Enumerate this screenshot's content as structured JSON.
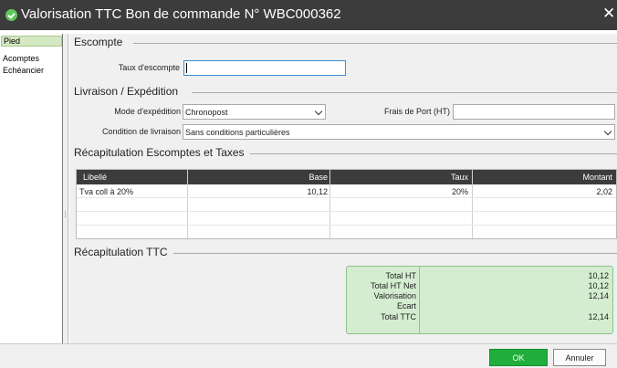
{
  "window": {
    "title": "Valorisation TTC Bon de commande N° WBC000362",
    "close_glyph": "✕",
    "icon": "green-check-badge-icon"
  },
  "sidebar": {
    "items": [
      "Pied",
      "Acomptes",
      "Echéancier"
    ],
    "active": "Pied"
  },
  "escompte": {
    "section_title": "Escompte",
    "rate_label": "Taux d'escompte",
    "rate_value": ""
  },
  "livraison": {
    "section_title": "Livraison / Expédition",
    "mode_label": "Mode d'expédition",
    "mode_value": "Chronopost",
    "frais_label": "Frais de Port (HT)",
    "frais_value": "",
    "condition_label": "Condition de livraison",
    "condition_value": "Sans conditions particulières"
  },
  "taxes": {
    "section_title": "Récapitulation Escomptes et Taxes",
    "columns": [
      "Libellé",
      "Base",
      "Taux",
      "Montant"
    ],
    "rows": [
      {
        "libelle": "Tva coll à 20%",
        "base": "10,12",
        "taux": "20%",
        "montant": "2,02"
      }
    ]
  },
  "ttc": {
    "section_title": "Récapitulation TTC",
    "lines": [
      {
        "label": "Total HT",
        "value": "10,12"
      },
      {
        "label": "Total HT Net",
        "value": "10,12"
      },
      {
        "label": "Valorisation",
        "value": "12,14"
      },
      {
        "label": "Ecart",
        "value": ""
      },
      {
        "label": "Total TTC",
        "value": "12,14"
      }
    ]
  },
  "buttons": {
    "ok": "OK",
    "cancel": "Annuler"
  },
  "colors": {
    "titlebar": "#3c3c3c",
    "accent_green": "#1fae3b",
    "recap_bg": "#d4ecd0",
    "focus_border": "#3b8ed8"
  }
}
